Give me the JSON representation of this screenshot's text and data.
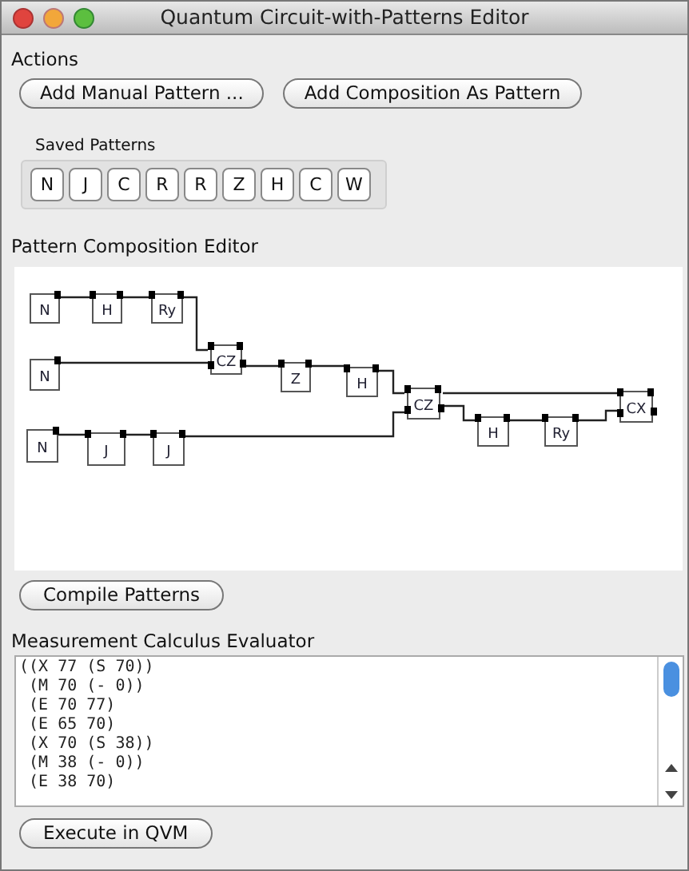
{
  "window": {
    "title": "Quantum Circuit-with-Patterns Editor"
  },
  "actions": {
    "heading": "Actions",
    "buttons": [
      "Add Manual Pattern ...",
      "Add Composition As Pattern"
    ]
  },
  "saved_patterns": {
    "label": "Saved Patterns",
    "items": [
      "N",
      "J",
      "C",
      "R",
      "R",
      "Z",
      "H",
      "C",
      "W"
    ]
  },
  "composition_editor": {
    "heading": "Pattern Composition Editor",
    "nodes": [
      {
        "label": "N"
      },
      {
        "label": "H"
      },
      {
        "label": "Ry"
      },
      {
        "label": "N"
      },
      {
        "label": "CZ"
      },
      {
        "label": "Z"
      },
      {
        "label": "H"
      },
      {
        "label": "CZ"
      },
      {
        "label": "N"
      },
      {
        "label": "J"
      },
      {
        "label": "J"
      },
      {
        "label": "H"
      },
      {
        "label": "Ry"
      },
      {
        "label": "CX"
      }
    ]
  },
  "compile_button": "Compile Patterns",
  "evaluator": {
    "heading": "Measurement Calculus Evaluator",
    "lines": [
      "((X 77 (S 70))",
      " (M 70 (- 0))",
      " (E 70 77)",
      " (E 65 70)",
      " (X 70 (S 38))",
      " (M 38 (- 0))",
      " (E 38 70)"
    ]
  },
  "execute_button": "Execute in QVM"
}
